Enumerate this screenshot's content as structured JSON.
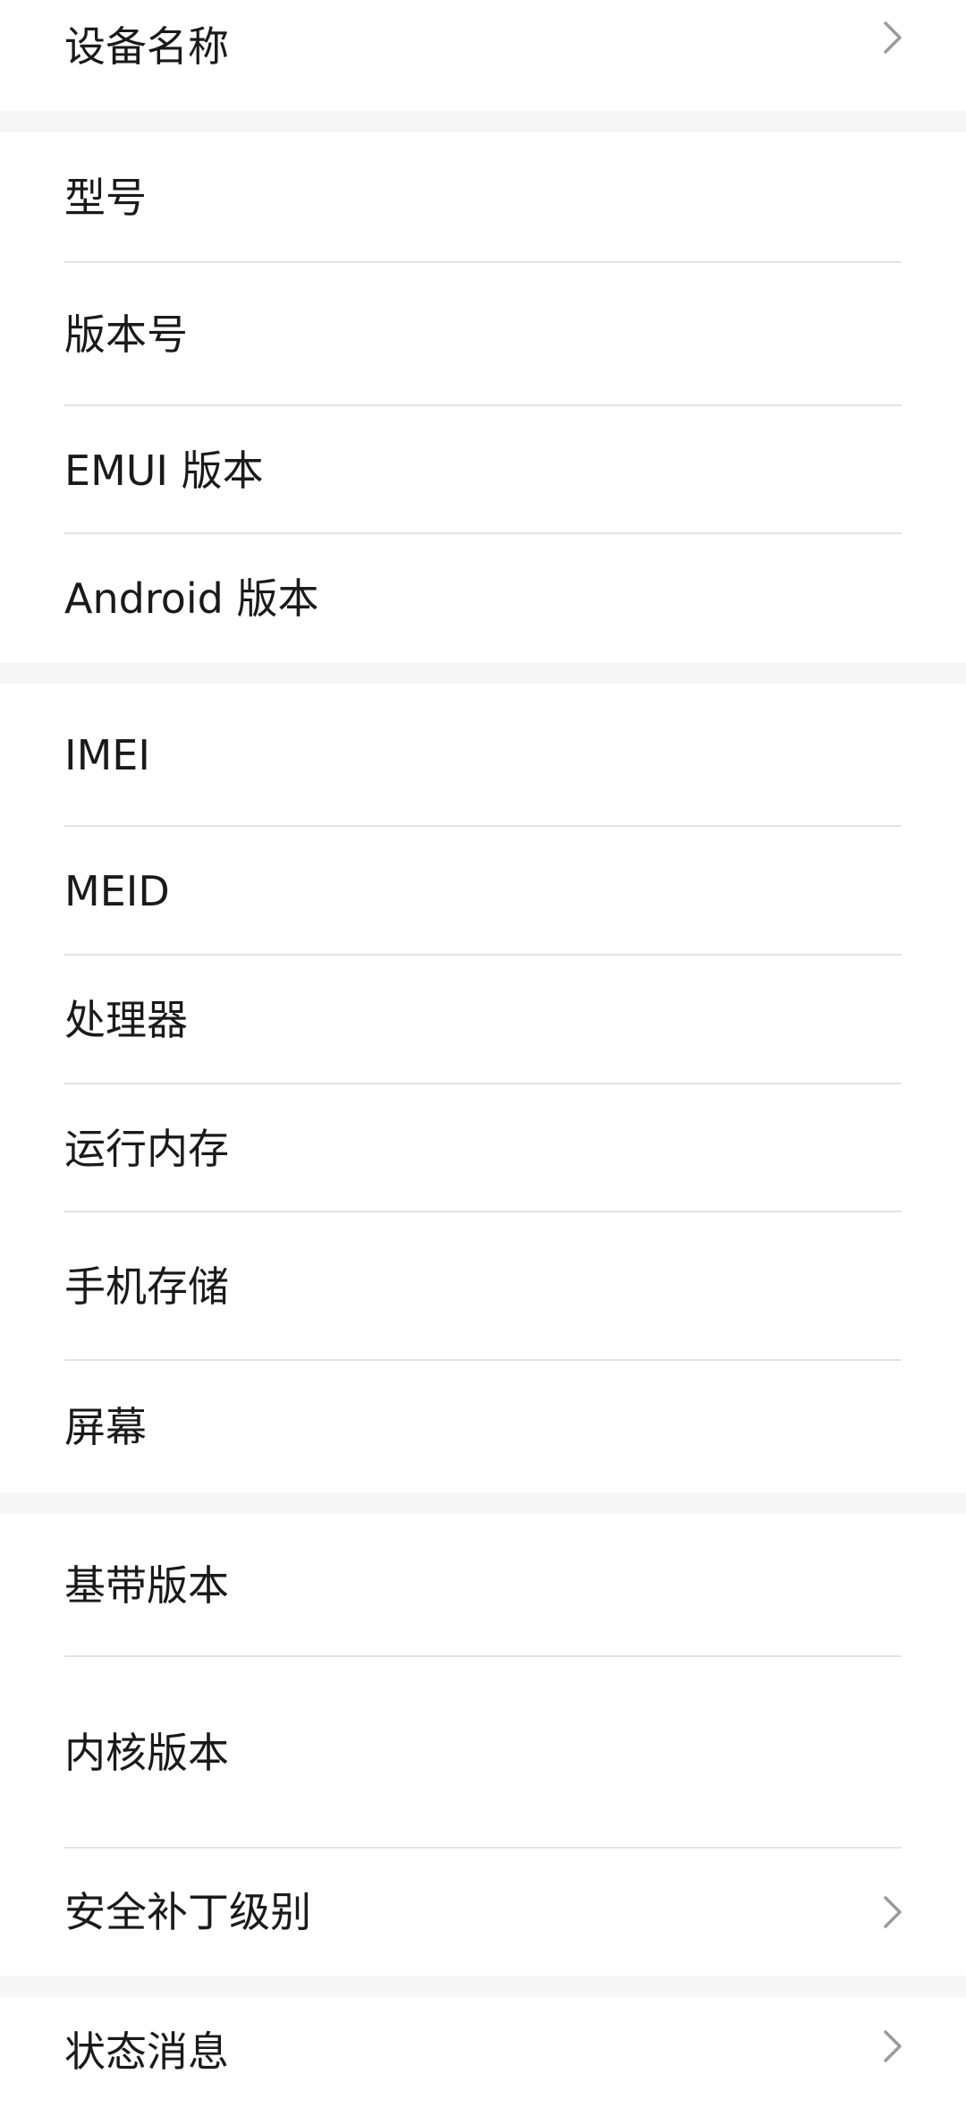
{
  "groups": [
    {
      "items": [
        {
          "label": "设备名称",
          "chevron": true
        }
      ]
    },
    {
      "items": [
        {
          "label": "型号",
          "chevron": false
        },
        {
          "label": "版本号",
          "chevron": false
        },
        {
          "label": "EMUI 版本",
          "chevron": false
        },
        {
          "label": "Android 版本",
          "chevron": false
        }
      ]
    },
    {
      "items": [
        {
          "label": "IMEI",
          "chevron": false
        },
        {
          "label": "MEID",
          "chevron": false
        },
        {
          "label": "处理器",
          "chevron": false
        },
        {
          "label": "运行内存",
          "chevron": false
        },
        {
          "label": "手机存储",
          "chevron": false
        },
        {
          "label": "屏幕",
          "chevron": false
        }
      ]
    },
    {
      "items": [
        {
          "label": "基带版本",
          "chevron": false
        },
        {
          "label": "内核版本",
          "chevron": false
        },
        {
          "label": "安全补丁级别",
          "chevron": true
        }
      ]
    },
    {
      "items": [
        {
          "label": "状态消息",
          "chevron": true
        }
      ]
    }
  ],
  "colors": {
    "page_background": "#f7f7f7",
    "card_background": "#ffffff",
    "divider": "#e3e3e3",
    "text": "#1a1a1a",
    "chevron": "#9a9a9a"
  },
  "icons": {
    "chevron": "chevron-right-icon"
  }
}
